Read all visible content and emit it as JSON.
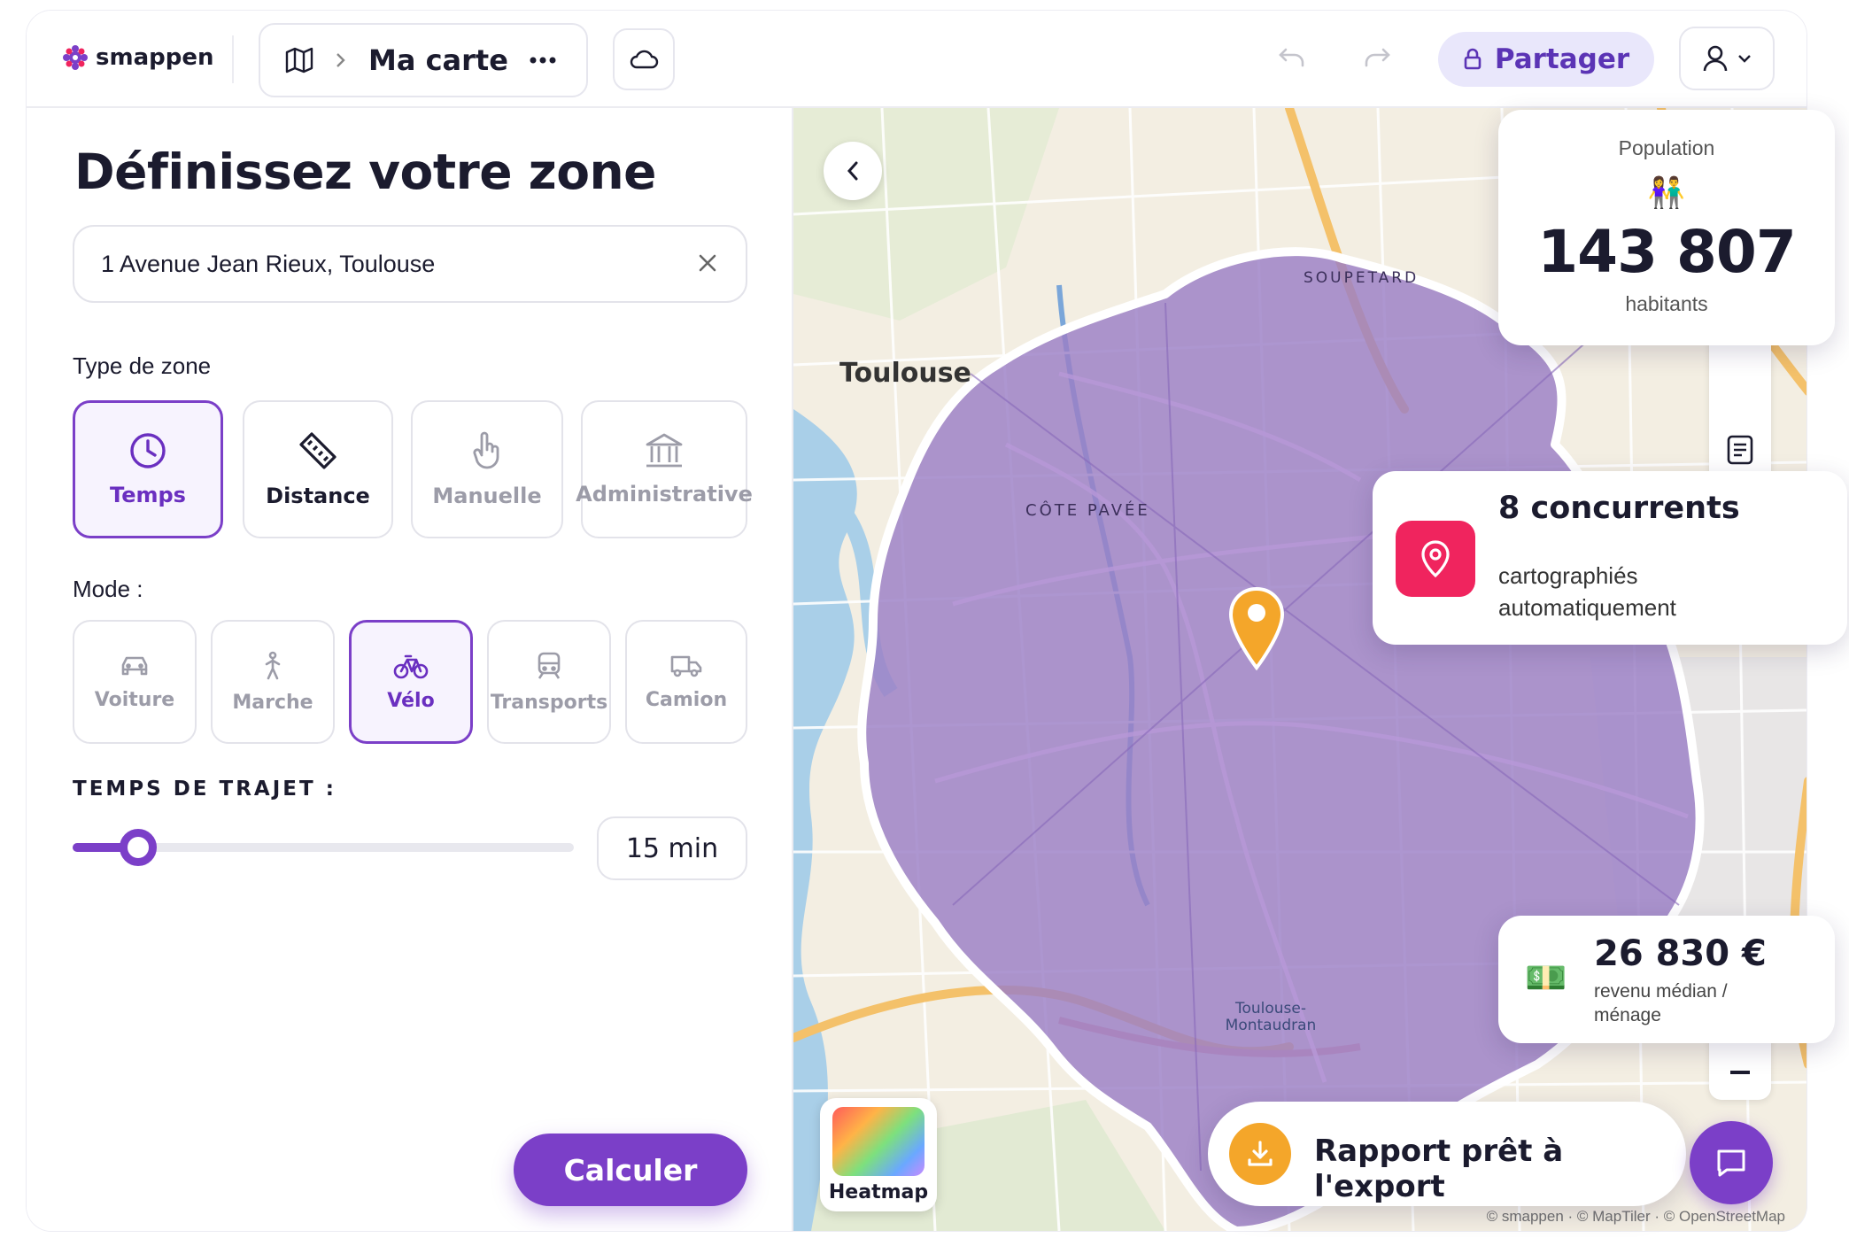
{
  "app": {
    "brand": "smappen",
    "brand_color": "#7b3fc8"
  },
  "topbar": {
    "breadcrumb_title": "Ma carte",
    "map_icon": "map-icon",
    "more_icon": "more-dots-icon",
    "cloud_icon": "cloud-icon",
    "undo_icon": "undo-icon",
    "redo_icon": "redo-icon",
    "share_label": "Partager",
    "share_icon": "lock-icon",
    "user_icon": "user-icon"
  },
  "panel": {
    "title": "Définissez votre zone",
    "address_value": "1 Avenue Jean Rieux, Toulouse",
    "zone_type_label": "Type de zone",
    "zone_types": [
      {
        "label": "Temps",
        "icon": "clock-icon",
        "selected": true
      },
      {
        "label": "Distance",
        "icon": "ruler-icon",
        "selected": false
      },
      {
        "label": "Manuelle",
        "icon": "hand-pointer-icon",
        "selected": false
      },
      {
        "label": "Administrative",
        "icon": "building-icon",
        "selected": false
      }
    ],
    "mode_label": "Mode :",
    "modes": [
      {
        "label": "Voiture",
        "icon": "car-icon",
        "selected": false
      },
      {
        "label": "Marche",
        "icon": "walk-icon",
        "selected": false
      },
      {
        "label": "Vélo",
        "icon": "bike-icon",
        "selected": true
      },
      {
        "label": "Transports",
        "icon": "train-icon",
        "selected": false
      },
      {
        "label": "Camion",
        "icon": "truck-icon",
        "selected": false
      }
    ],
    "travel_time_label": "TEMPS DE TRAJET :",
    "travel_time_value": "15 min",
    "slider_fraction": 0.13,
    "calculate_label": "Calculer"
  },
  "map": {
    "labels": {
      "city": "Toulouse",
      "district_1": "CÔTE PAVÉE",
      "district_2": "SOUPETARD",
      "station": "Toulouse-Montaudran"
    },
    "zone_color": "#9b7fc6",
    "marker_color": "#f4a62a",
    "heatmap_label": "Heatmap",
    "attribution": "© smappen · © MapTiler · © OpenStreetMap"
  },
  "cards": {
    "population": {
      "title": "Population",
      "value": "143 807",
      "unit": "habitants",
      "icon": "people-emoji-icon"
    },
    "competitors": {
      "title": "8 concurrents",
      "subtitle": "cartographiés automatiquement",
      "icon": "location-pin-icon"
    },
    "income": {
      "value": "26 830 €",
      "subtitle": "revenu médian / ménage",
      "icon": "money-icon"
    },
    "export": {
      "label": "Rapport prêt à l'export",
      "icon": "download-icon"
    },
    "chat_icon": "chat-icon"
  }
}
